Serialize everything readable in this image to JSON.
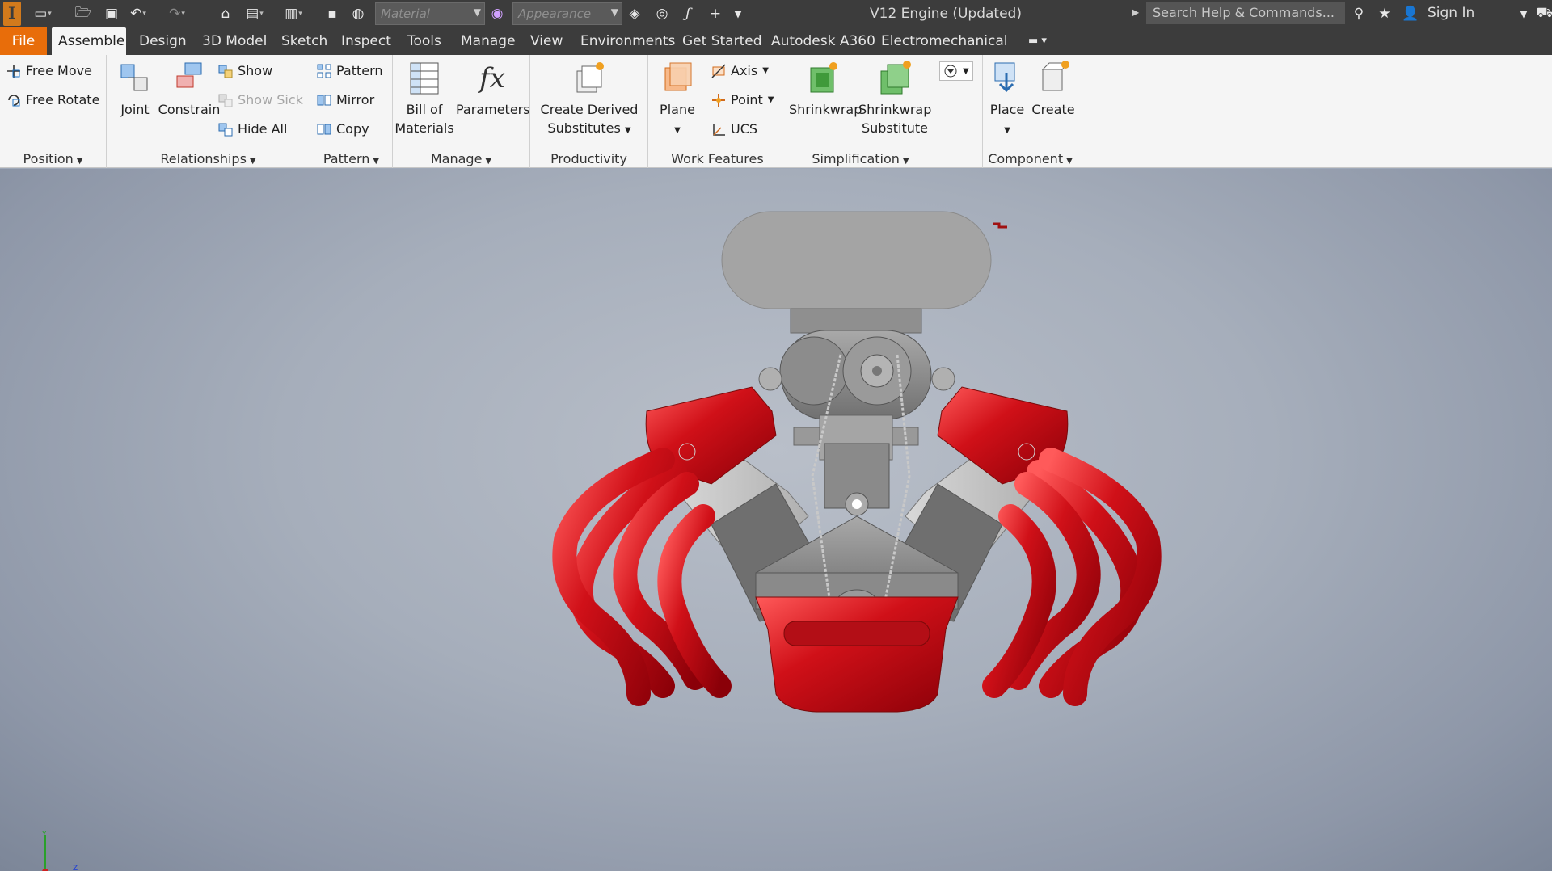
{
  "title_bar": {
    "material_placeholder": "Material",
    "appearance_placeholder": "Appearance",
    "document_title": "V12 Engine (Updated)",
    "search_placeholder": "Search Help & Commands...",
    "sign_in": "Sign In"
  },
  "tabs": [
    {
      "label": "File"
    },
    {
      "label": "Assemble"
    },
    {
      "label": "Design"
    },
    {
      "label": "3D Model"
    },
    {
      "label": "Sketch"
    },
    {
      "label": "Inspect"
    },
    {
      "label": "Tools"
    },
    {
      "label": "Manage"
    },
    {
      "label": "View"
    },
    {
      "label": "Environments"
    },
    {
      "label": "Get Started"
    },
    {
      "label": "Autodesk A360"
    },
    {
      "label": "Electromechanical"
    }
  ],
  "ribbon": {
    "position": {
      "label": "Position",
      "free_move": "Free Move",
      "free_rotate": "Free Rotate"
    },
    "relationships": {
      "label": "Relationships",
      "joint": "Joint",
      "constrain": "Constrain",
      "show": "Show",
      "show_sick": "Show Sick",
      "hide_all": "Hide All"
    },
    "pattern": {
      "label": "Pattern",
      "pattern": "Pattern",
      "mirror": "Mirror",
      "copy": "Copy"
    },
    "manage": {
      "label": "Manage",
      "bom_line1": "Bill of",
      "bom_line2": "Materials",
      "parameters": "Parameters"
    },
    "productivity": {
      "label": "Productivity",
      "derived_line1": "Create Derived",
      "derived_line2": "Substitutes"
    },
    "work_features": {
      "label": "Work Features",
      "plane": "Plane",
      "axis": "Axis",
      "point": "Point",
      "ucs": "UCS"
    },
    "simplification": {
      "label": "Simplification",
      "shrinkwrap": "Shrinkwrap",
      "shrinkwrap_sub_line1": "Shrinkwrap",
      "shrinkwrap_sub_line2": "Substitute"
    },
    "component": {
      "label": "Component",
      "place": "Place",
      "create": "Create"
    }
  },
  "colors": {
    "file_tab": "#e86d0a",
    "title_bar": "#3c3c3c",
    "ribbon": "#f5f5f5",
    "engine_red": "#c8101a",
    "engine_gray": "#8b8b8b"
  },
  "viewport": {
    "model": "V12 engine assembly",
    "axis_triad_labels": [
      "Y",
      "Z"
    ]
  }
}
